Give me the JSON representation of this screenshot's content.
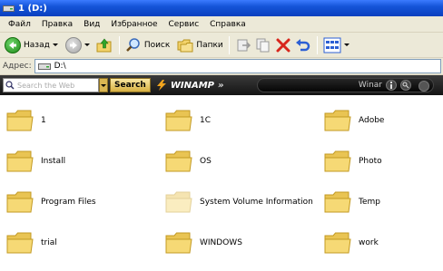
{
  "window": {
    "title": "1 (D:)"
  },
  "menu": [
    "Файл",
    "Правка",
    "Вид",
    "Избранное",
    "Сервис",
    "Справка"
  ],
  "toolbar": {
    "back_label": "Назад",
    "search_label": "Поиск",
    "folders_label": "Папки"
  },
  "address": {
    "label": "Адрес:",
    "value": "D:\\"
  },
  "winamp": {
    "search_placeholder": "Search the Web",
    "search_button": "Search",
    "brand": "WINAMP",
    "chevrons": "»",
    "player_label": "Winar"
  },
  "folders": [
    {
      "name": "1"
    },
    {
      "name": "1C"
    },
    {
      "name": "Adobe"
    },
    {
      "name": "Install"
    },
    {
      "name": "OS"
    },
    {
      "name": "Photo"
    },
    {
      "name": "Program Files"
    },
    {
      "name": "System Volume Information",
      "hidden": true
    },
    {
      "name": "Temp"
    },
    {
      "name": "trial"
    },
    {
      "name": "WINDOWS"
    },
    {
      "name": "work"
    }
  ],
  "colors": {
    "title_bar": "#1454d8",
    "chrome": "#ece9d8",
    "folder": "#f3d36b"
  }
}
